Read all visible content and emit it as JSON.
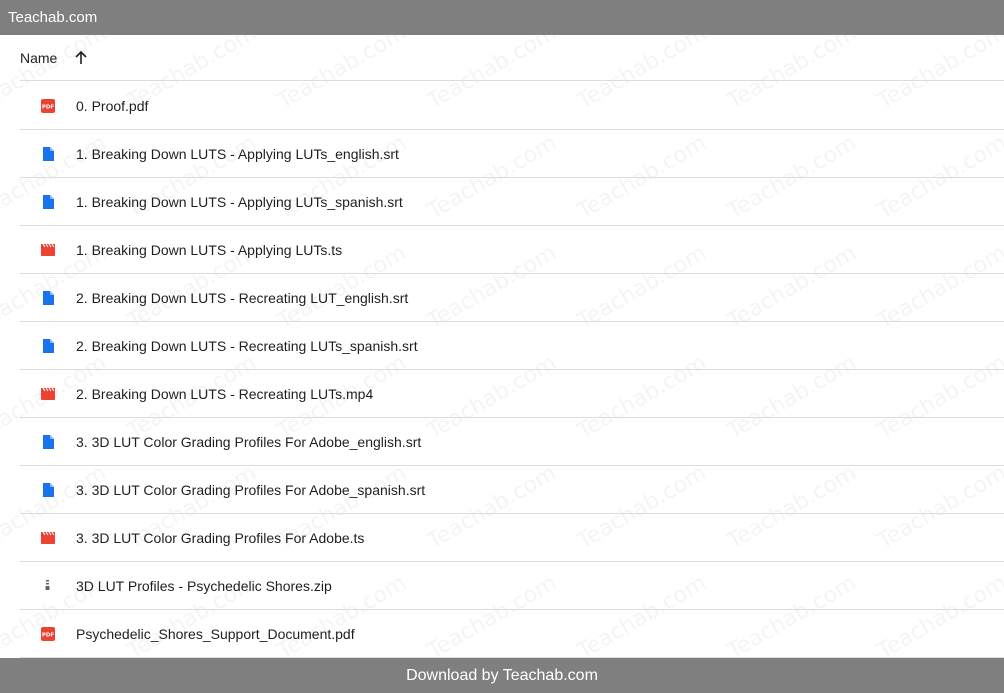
{
  "topbar": {
    "title": "Teachab.com"
  },
  "header": {
    "name_label": "Name",
    "sort_icon": "arrow-up-icon"
  },
  "files": [
    {
      "name": "0. Proof.pdf",
      "icon": "pdf-icon"
    },
    {
      "name": "1. Breaking Down LUTS - Applying LUTs_english.srt",
      "icon": "document-icon"
    },
    {
      "name": "1. Breaking Down LUTS - Applying LUTs_spanish.srt",
      "icon": "document-icon"
    },
    {
      "name": "1. Breaking Down LUTS - Applying LUTs.ts",
      "icon": "video-icon"
    },
    {
      "name": "2. Breaking Down LUTS - Recreating LUT_english.srt",
      "icon": "document-icon"
    },
    {
      "name": "2. Breaking Down LUTS - Recreating LUTs_spanish.srt",
      "icon": "document-icon"
    },
    {
      "name": "2. Breaking Down LUTS - Recreating LUTs.mp4",
      "icon": "video-icon"
    },
    {
      "name": "3. 3D LUT Color Grading Profiles For Adobe_english.srt",
      "icon": "document-icon"
    },
    {
      "name": "3. 3D LUT Color Grading Profiles For Adobe_spanish.srt",
      "icon": "document-icon"
    },
    {
      "name": "3. 3D LUT Color Grading Profiles For Adobe.ts",
      "icon": "video-icon"
    },
    {
      "name": "3D LUT Profiles - Psychedelic Shores.zip",
      "icon": "zip-icon"
    },
    {
      "name": "Psychedelic_Shores_Support_Document.pdf",
      "icon": "pdf-icon"
    }
  ],
  "bottombar": {
    "text": "Download by Teachab.com"
  },
  "watermark": {
    "text": "Teachab.com"
  },
  "colors": {
    "bar": "#7f7f7f",
    "pdf": "#ea4335",
    "document": "#1a73e8",
    "video": "#ea4335",
    "zip": "#5f6368",
    "divider": "#dadce0"
  }
}
